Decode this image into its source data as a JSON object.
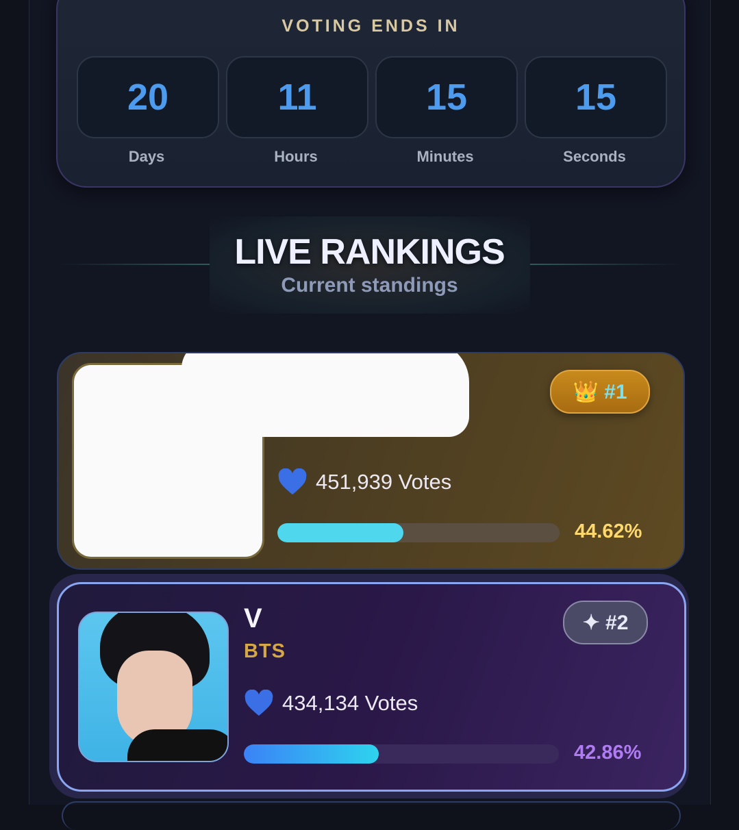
{
  "countdown": {
    "title": "VOTING ENDS IN",
    "units": [
      {
        "value": "20",
        "label": "Days"
      },
      {
        "value": "11",
        "label": "Hours"
      },
      {
        "value": "15",
        "label": "Minutes"
      },
      {
        "value": "15",
        "label": "Seconds"
      }
    ]
  },
  "rankings": {
    "title": "LIVE RANKINGS",
    "subtitle": "Current standings"
  },
  "entries": [
    {
      "badge": "👑 #1",
      "votes": "451,939 Votes",
      "percent": "44.62%",
      "progress": 0.4462,
      "accent": "#ffd86b"
    },
    {
      "name": "V",
      "group": "BTS",
      "badge": "✦ #2",
      "votes": "434,134 Votes",
      "percent": "42.86%",
      "progress": 0.4286,
      "accent": "#b07cf2"
    }
  ],
  "colors": {
    "countdown_digits": "#4d9bef",
    "heart": "#3a6fe6",
    "bar1": "#4fd7ee",
    "bar2_start": "#3b82f6",
    "bar2_end": "#2ed3ee"
  },
  "icons": [
    "heart-icon",
    "crown-icon",
    "sparkle-icon"
  ]
}
